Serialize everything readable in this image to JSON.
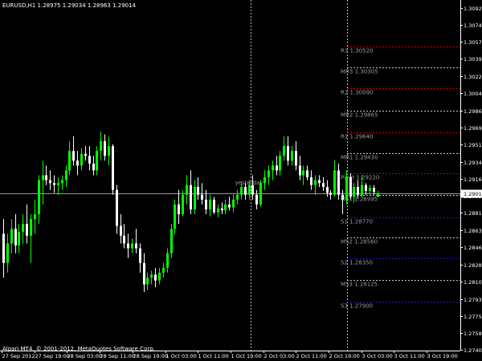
{
  "header": {
    "symbol": "EURUSD,H1",
    "ohlc": "1.28975 1.29034 1.28963 1.29014"
  },
  "copyright": "Alpari MT4, © 2001-2012, MetaQuotes Software Corp.",
  "yesterday_label": "yesterday",
  "colors": {
    "background": "#000000",
    "bull": "#00ff00",
    "bear": "#ffffff",
    "bid_line": "#9a9a9a",
    "resistance": "#c80000",
    "midpoint": "#c8c8c8",
    "support": "#1a1acc",
    "axis_text": "#ffffff",
    "level_text": "#9a9a9a"
  },
  "chart_data": {
    "type": "candlestick",
    "symbol": "EURUSD",
    "timeframe": "H1",
    "current_price": 1.29014,
    "ylim": [
      1.274,
      1.31
    ],
    "y_ticks": [
      1.3092,
      1.30745,
      1.3057,
      1.30395,
      1.3022,
      1.30045,
      1.29865,
      1.2969,
      1.29515,
      1.2934,
      1.29165,
      1.2899,
      1.28815,
      1.28635,
      1.2846,
      1.28285,
      1.28105,
      1.2793,
      1.27755,
      1.2758,
      1.27405
    ],
    "x_ticks": [
      "27 Sep 2012",
      "27 Sep 19:00",
      "28 Sep 03:00",
      "28 Sep 11:00",
      "28 Sep 19:00",
      "1 Oct 03:00",
      "1 Oct 11:00",
      "1 Oct 19:00",
      "2 Oct 03:00",
      "2 Oct 11:00",
      "2 Oct 19:00",
      "3 Oct 03:00",
      "3 Oct 11:00",
      "3 Oct 19:00"
    ],
    "pivot_levels": [
      {
        "label": "R3",
        "value": "1.30520",
        "kind": "resistance"
      },
      {
        "label": "MR3",
        "value": "1.30305",
        "kind": "mid"
      },
      {
        "label": "R2",
        "value": "1.30090",
        "kind": "resistance"
      },
      {
        "label": "MR2",
        "value": "1.29865",
        "kind": "mid"
      },
      {
        "label": "R1",
        "value": "1.29640",
        "kind": "resistance"
      },
      {
        "label": "MR1",
        "value": "1.29430",
        "kind": "mid"
      },
      {
        "label": "Pivot",
        "value": "1.29220",
        "kind": "resistance"
      },
      {
        "label": "MS1",
        "value": "1.28995",
        "kind": "mid"
      },
      {
        "label": "S1",
        "value": "1.28770",
        "kind": "support"
      },
      {
        "label": "MS2",
        "value": "1.28560",
        "kind": "mid"
      },
      {
        "label": "S2",
        "value": "1.28350",
        "kind": "support"
      },
      {
        "label": "MS3",
        "value": "1.28125",
        "kind": "mid"
      },
      {
        "label": "S3",
        "value": "1.27900",
        "kind": "support"
      }
    ],
    "candles": [
      [
        1.286,
        1.2875,
        1.2815,
        1.283
      ],
      [
        1.283,
        1.286,
        1.282,
        1.285
      ],
      [
        1.285,
        1.2875,
        1.284,
        1.2865
      ],
      [
        1.2865,
        1.288,
        1.284,
        1.2848
      ],
      [
        1.2848,
        1.287,
        1.284,
        1.2862
      ],
      [
        1.2862,
        1.288,
        1.285,
        1.287
      ],
      [
        1.287,
        1.289,
        1.285,
        1.2858
      ],
      [
        1.2858,
        1.288,
        1.283,
        1.2875
      ],
      [
        1.2875,
        1.2895,
        1.286,
        1.288
      ],
      [
        1.288,
        1.292,
        1.287,
        1.2915
      ],
      [
        1.2915,
        1.2935,
        1.289,
        1.292
      ],
      [
        1.292,
        1.293,
        1.291,
        1.2915
      ],
      [
        1.2915,
        1.2925,
        1.2905,
        1.2912
      ],
      [
        1.2912,
        1.292,
        1.2902,
        1.291
      ],
      [
        1.291,
        1.2918,
        1.29,
        1.2912
      ],
      [
        1.2912,
        1.292,
        1.2905,
        1.2915
      ],
      [
        1.2915,
        1.293,
        1.2908,
        1.2925
      ],
      [
        1.2925,
        1.2955,
        1.292,
        1.2945
      ],
      [
        1.2945,
        1.296,
        1.293,
        1.2935
      ],
      [
        1.2935,
        1.2945,
        1.292,
        1.293
      ],
      [
        1.293,
        1.2948,
        1.2925,
        1.2942
      ],
      [
        1.2942,
        1.295,
        1.2935,
        1.294
      ],
      [
        1.294,
        1.295,
        1.2925,
        1.2932
      ],
      [
        1.2932,
        1.294,
        1.292,
        1.2925
      ],
      [
        1.2925,
        1.295,
        1.292,
        1.2945
      ],
      [
        1.2945,
        1.2965,
        1.2935,
        1.2955
      ],
      [
        1.2955,
        1.2962,
        1.2935,
        1.294
      ],
      [
        1.294,
        1.296,
        1.293,
        1.295
      ],
      [
        1.295,
        1.2952,
        1.29,
        1.2905
      ],
      [
        1.2905,
        1.291,
        1.286,
        1.2868
      ],
      [
        1.2868,
        1.288,
        1.285,
        1.2858
      ],
      [
        1.2858,
        1.287,
        1.2845,
        1.285
      ],
      [
        1.285,
        1.286,
        1.2835,
        1.2845
      ],
      [
        1.2845,
        1.2855,
        1.284,
        1.285
      ],
      [
        1.285,
        1.2865,
        1.284,
        1.2845
      ],
      [
        1.2845,
        1.285,
        1.282,
        1.283
      ],
      [
        1.283,
        1.284,
        1.28,
        1.2808
      ],
      [
        1.2808,
        1.282,
        1.2802,
        1.2815
      ],
      [
        1.2815,
        1.2822,
        1.2808,
        1.2818
      ],
      [
        1.2818,
        1.2825,
        1.2805,
        1.2812
      ],
      [
        1.2812,
        1.2825,
        1.2808,
        1.282
      ],
      [
        1.282,
        1.283,
        1.2815,
        1.2825
      ],
      [
        1.2825,
        1.2845,
        1.282,
        1.284
      ],
      [
        1.284,
        1.287,
        1.2835,
        1.2865
      ],
      [
        1.2865,
        1.2895,
        1.286,
        1.289
      ],
      [
        1.289,
        1.2905,
        1.287,
        1.288
      ],
      [
        1.288,
        1.2905,
        1.2878,
        1.29
      ],
      [
        1.29,
        1.292,
        1.289,
        1.291
      ],
      [
        1.291,
        1.2925,
        1.288,
        1.2885
      ],
      [
        1.2885,
        1.2915,
        1.288,
        1.2908
      ],
      [
        1.2908,
        1.2918,
        1.2895,
        1.29
      ],
      [
        1.29,
        1.2912,
        1.289,
        1.2895
      ],
      [
        1.2895,
        1.2905,
        1.288,
        1.2885
      ],
      [
        1.2885,
        1.29,
        1.2878,
        1.2895
      ],
      [
        1.2895,
        1.2898,
        1.288,
        1.2882
      ],
      [
        1.2882,
        1.289,
        1.2877,
        1.2886
      ],
      [
        1.2886,
        1.2892,
        1.288,
        1.2884
      ],
      [
        1.2884,
        1.2895,
        1.288,
        1.289
      ],
      [
        1.289,
        1.2898,
        1.2884,
        1.2887
      ],
      [
        1.2887,
        1.29,
        1.2882,
        1.2895
      ],
      [
        1.2895,
        1.2905,
        1.289,
        1.29
      ],
      [
        1.29,
        1.2912,
        1.2895,
        1.2908
      ],
      [
        1.2908,
        1.2912,
        1.2895,
        1.29
      ],
      [
        1.29,
        1.2915,
        1.2895,
        1.291
      ],
      [
        1.291,
        1.292,
        1.2895,
        1.29
      ],
      [
        1.29,
        1.2905,
        1.2885,
        1.289
      ],
      [
        1.289,
        1.2915,
        1.2888,
        1.2912
      ],
      [
        1.2912,
        1.2925,
        1.2905,
        1.2918
      ],
      [
        1.2918,
        1.293,
        1.291,
        1.2925
      ],
      [
        1.2925,
        1.2935,
        1.2915,
        1.293
      ],
      [
        1.293,
        1.294,
        1.292,
        1.2925
      ],
      [
        1.2925,
        1.2945,
        1.292,
        1.294
      ],
      [
        1.294,
        1.296,
        1.2935,
        1.295
      ],
      [
        1.295,
        1.296,
        1.293,
        1.2935
      ],
      [
        1.2935,
        1.295,
        1.293,
        1.2945
      ],
      [
        1.2945,
        1.2955,
        1.2925,
        1.293
      ],
      [
        1.293,
        1.294,
        1.2915,
        1.292
      ],
      [
        1.292,
        1.293,
        1.291,
        1.2925
      ],
      [
        1.2925,
        1.293,
        1.2915,
        1.2918
      ],
      [
        1.2918,
        1.2925,
        1.2905,
        1.291
      ],
      [
        1.291,
        1.292,
        1.29,
        1.2915
      ],
      [
        1.2915,
        1.292,
        1.2908,
        1.2912
      ],
      [
        1.2912,
        1.2918,
        1.2904,
        1.2908
      ],
      [
        1.2908,
        1.2915,
        1.2898,
        1.2902
      ],
      [
        1.2902,
        1.2905,
        1.2895,
        1.29
      ],
      [
        1.29,
        1.2935,
        1.2898,
        1.2925
      ],
      [
        1.2925,
        1.2932,
        1.2895,
        1.29
      ],
      [
        1.29,
        1.2905,
        1.288,
        1.2895
      ],
      [
        1.2895,
        1.2925,
        1.289,
        1.2918
      ],
      [
        1.2918,
        1.2922,
        1.2895,
        1.2898
      ],
      [
        1.2898,
        1.2912,
        1.2892,
        1.2908
      ],
      [
        1.2908,
        1.2915,
        1.2896,
        1.29
      ],
      [
        1.29,
        1.292,
        1.2898,
        1.291
      ],
      [
        1.291,
        1.2912,
        1.29,
        1.2904
      ],
      [
        1.2904,
        1.291,
        1.29,
        1.2907
      ],
      [
        1.2907,
        1.291,
        1.29,
        1.2903
      ],
      [
        1.2898,
        1.2904,
        1.2897,
        1.2901
      ]
    ]
  }
}
